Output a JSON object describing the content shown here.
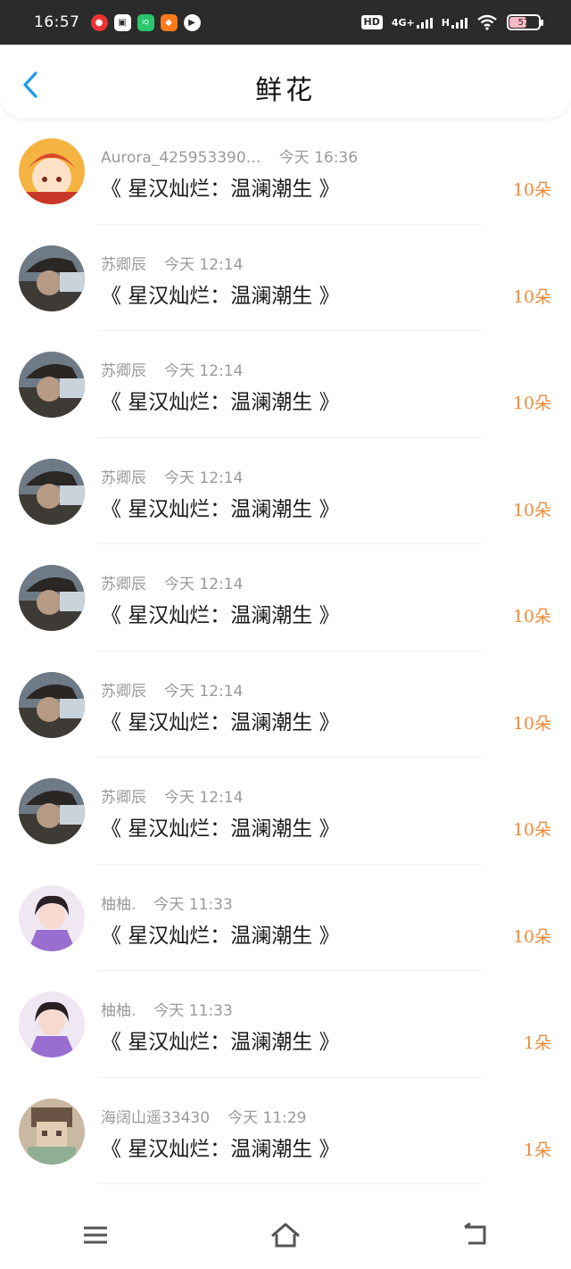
{
  "status_bar": {
    "time": "16:57",
    "app_icons": [
      "netease-music-icon",
      "bilibili-icon",
      "iqiyi-icon",
      "mango-tv-icon",
      "play-icon"
    ],
    "hd_label": "HD",
    "network_label": "4G+",
    "network2_label": "H",
    "battery_level": "57"
  },
  "header": {
    "title": "鲜花"
  },
  "gifts": [
    {
      "user": "Aurora_425953390…",
      "time": "今天 16:36",
      "book": "《 星汉灿烂：温澜潮生 》",
      "amount": "10朵",
      "avatar": "anime"
    },
    {
      "user": "苏卿辰",
      "time": "今天 12:14",
      "book": "《 星汉灿烂：温澜潮生 》",
      "amount": "10朵",
      "avatar": "photo"
    },
    {
      "user": "苏卿辰",
      "time": "今天 12:14",
      "book": "《 星汉灿烂：温澜潮生 》",
      "amount": "10朵",
      "avatar": "photo"
    },
    {
      "user": "苏卿辰",
      "time": "今天 12:14",
      "book": "《 星汉灿烂：温澜潮生 》",
      "amount": "10朵",
      "avatar": "photo"
    },
    {
      "user": "苏卿辰",
      "time": "今天 12:14",
      "book": "《 星汉灿烂：温澜潮生 》",
      "amount": "10朵",
      "avatar": "photo"
    },
    {
      "user": "苏卿辰",
      "time": "今天 12:14",
      "book": "《 星汉灿烂：温澜潮生 》",
      "amount": "10朵",
      "avatar": "photo"
    },
    {
      "user": "苏卿辰",
      "time": "今天 12:14",
      "book": "《 星汉灿烂：温澜潮生 》",
      "amount": "10朵",
      "avatar": "photo"
    },
    {
      "user": "柚柚.",
      "time": "今天 11:33",
      "book": "《 星汉灿烂：温澜潮生 》",
      "amount": "10朵",
      "avatar": "girl"
    },
    {
      "user": "柚柚.",
      "time": "今天 11:33",
      "book": "《 星汉灿烂：温澜潮生 》",
      "amount": "1朵",
      "avatar": "girl"
    },
    {
      "user": "海阔山遥33430",
      "time": "今天 11:29",
      "book": "《 星汉灿烂：温澜潮生 》",
      "amount": "1朵",
      "avatar": "pixel"
    }
  ],
  "nav": {
    "items": [
      "menu-icon",
      "home-icon",
      "back-icon"
    ]
  },
  "colors": {
    "accent_blue": "#1e9bf0",
    "amount_orange": "#f08a3b",
    "meta_gray": "#9a9a9a",
    "status_bar_bg": "#2b2b2b"
  }
}
